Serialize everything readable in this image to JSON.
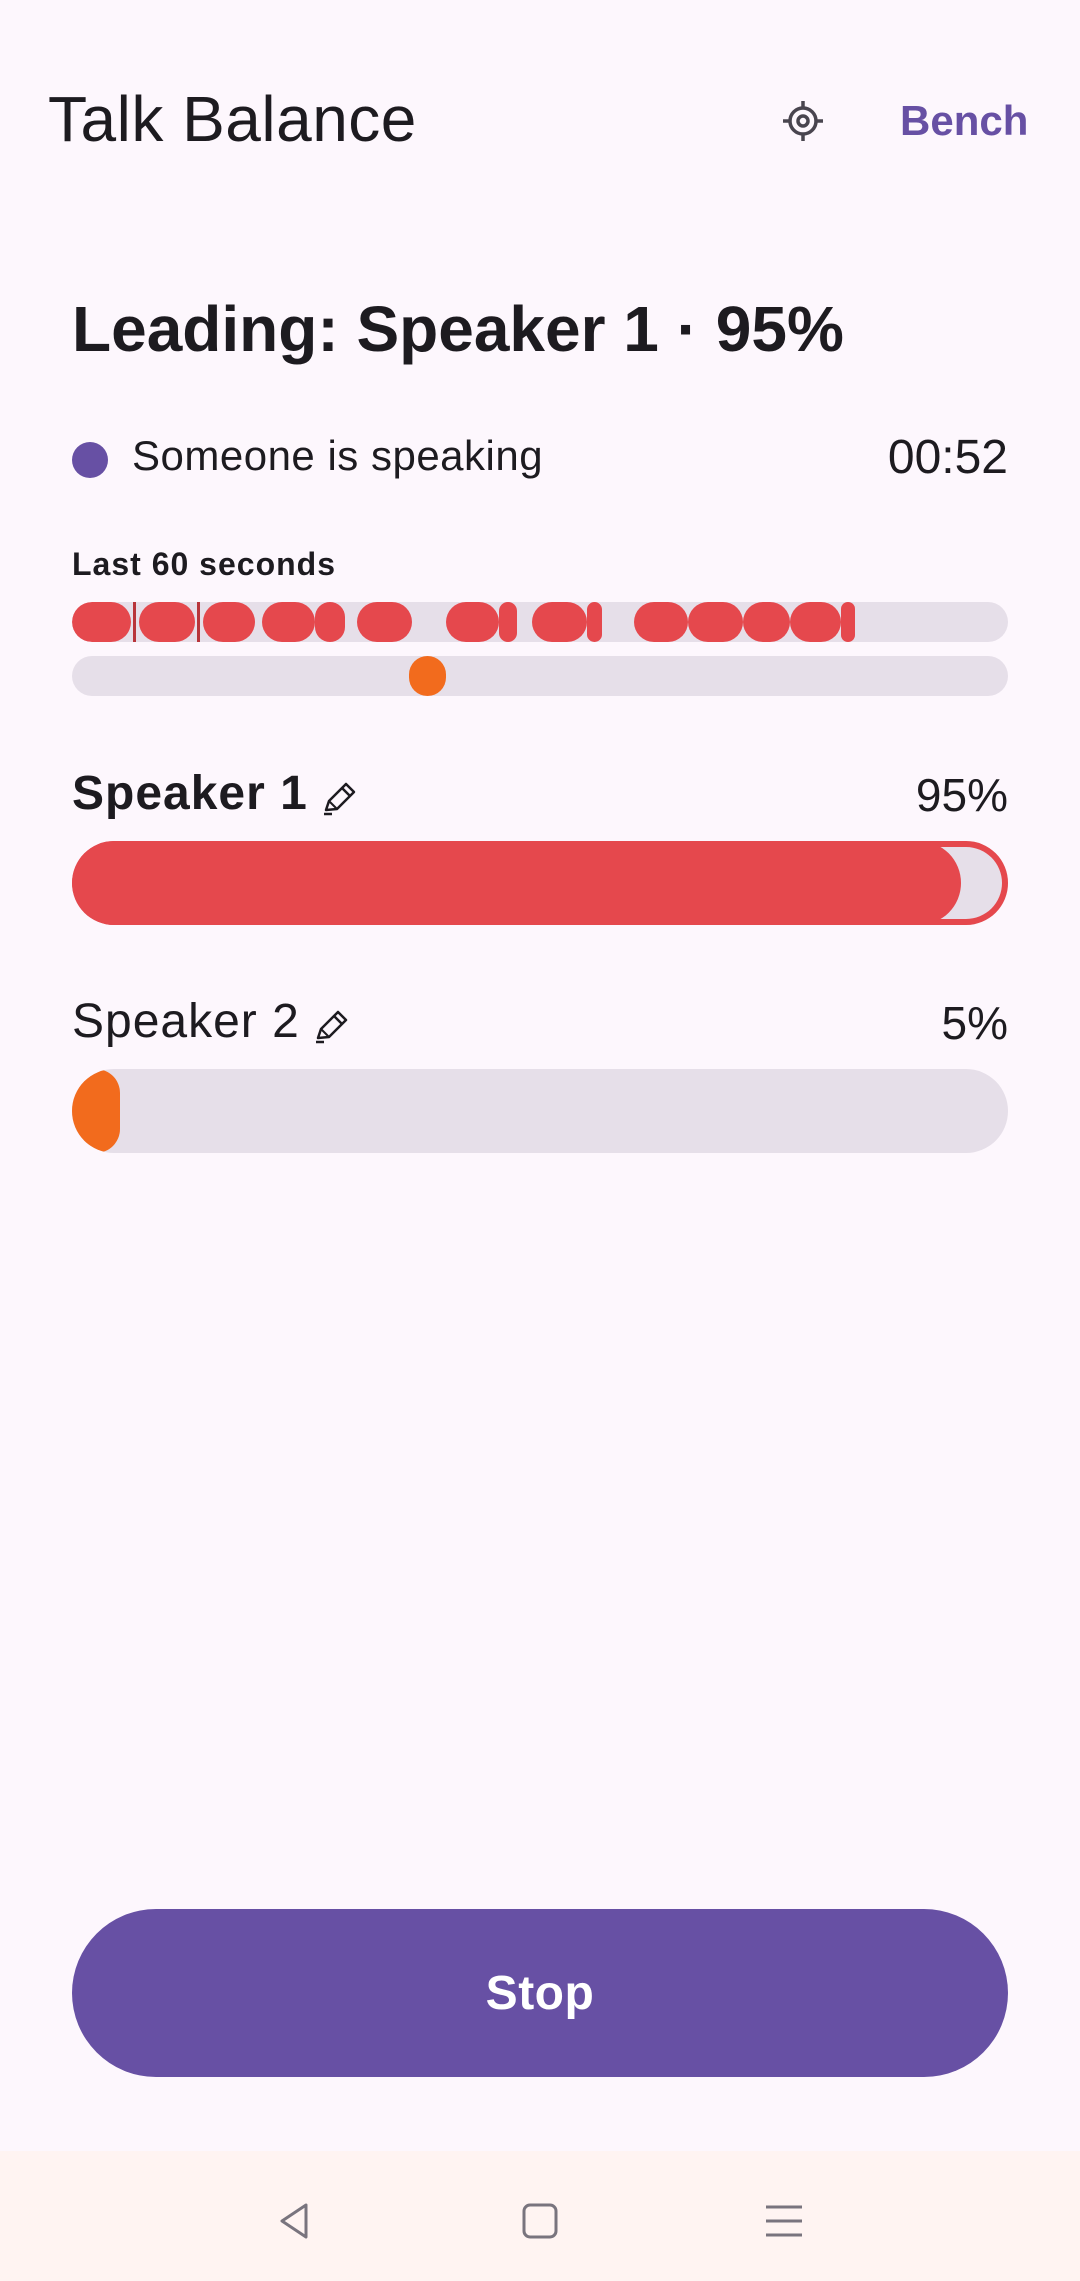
{
  "app": {
    "title": "Talk Balance",
    "settings_icon": "gear-icon",
    "bench_label": "Bench"
  },
  "headline": "Leading: Speaker 1 · 95%",
  "status": {
    "text": "Someone is speaking",
    "timer": "00:52",
    "dot_color": "#6750a4"
  },
  "timeline": {
    "label": "Last 60 seconds",
    "window_seconds": 60,
    "speaker1_color": "#e5484d",
    "speaker2_color": "#f26b1d",
    "speaker1_segments": [
      [
        0.0,
        3.8
      ],
      [
        4.3,
        7.9
      ],
      [
        8.4,
        11.7
      ],
      [
        12.2,
        15.6
      ],
      [
        15.6,
        17.5
      ],
      [
        18.3,
        21.8
      ],
      [
        24.0,
        27.4
      ],
      [
        27.4,
        28.5
      ],
      [
        29.5,
        33.0
      ],
      [
        33.0,
        34.0
      ],
      [
        36.0,
        39.5
      ],
      [
        39.5,
        43.0
      ],
      [
        43.0,
        46.0
      ],
      [
        46.0,
        49.3
      ],
      [
        49.3,
        50.1
      ]
    ],
    "speaker1_dividers": [
      3.9,
      8.0
    ],
    "speaker2_segments": [
      [
        21.6,
        24.0
      ]
    ]
  },
  "speakers": [
    {
      "name": "Speaker 1",
      "percent_label": "95%",
      "share": 0.95,
      "color": "#e5484d",
      "edit_icon": "pencil-icon"
    },
    {
      "name": "Speaker 2",
      "percent_label": "5%",
      "share": 0.05,
      "color": "#f26b1d",
      "edit_icon": "pencil-icon"
    }
  ],
  "stop_label": "Stop",
  "nav": {
    "back_icon": "back-icon",
    "home_icon": "home-icon",
    "menu_icon": "menu-icon"
  }
}
